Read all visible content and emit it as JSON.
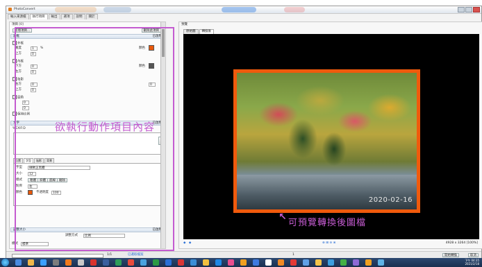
{
  "window": {
    "title": "PhotoConvert",
    "deco_colors": [
      "#e9a86a",
      "#9fb7d4",
      "#6aa0e6",
      "#e46e6e"
    ]
  },
  "main_tabs": [
    "輸入來源檔",
    "執行項目",
    "輸出",
    "選項",
    "說明",
    "關於"
  ],
  "left": {
    "header_label": "項目 [0]",
    "add_button": "新增項目...",
    "delete_button": "刪除此項目",
    "section1_title": "邊框",
    "section1_right": "已啟用",
    "group_outer": "外框",
    "color_label": "顏色",
    "size_label": "寬度",
    "size_value": "1",
    "size_unit": "%",
    "row_a": "上方",
    "row_b": "下方",
    "row_c": "左方",
    "row_d": "右方",
    "value_zero": "0",
    "group_inner": "內框",
    "group_shadow": "陰影",
    "group_round": "圓角",
    "keep_ratio": "保持比例",
    "annotation": "欲執行動作項目內容",
    "section2_title": "文字",
    "section2_right": "已啟用",
    "text_content": "%EXIF:D",
    "sub_tabs": [
      "位置",
      "字型",
      "陰影",
      "背景"
    ],
    "font_label": "字型",
    "font_value": "微軟正黑體",
    "size_row": "大小",
    "size_row_value": "12",
    "style_label": "樣式",
    "style_buttons": [
      "粗體",
      "斜體",
      "底線",
      "刪除"
    ],
    "align_label": "對齊",
    "align_value": "左",
    "color_row": "顏色",
    "opacity_label": "不透明度",
    "opacity_value": "100",
    "section3_title": "調整大小",
    "section3_right": "已啟用",
    "method_label": "調整方式",
    "method_value": "比例",
    "bottom_label": "模式",
    "bottom_value": "標準"
  },
  "right": {
    "header": "預覽",
    "tabs": [
      "原始圖",
      "轉換後"
    ],
    "timestamp": "2020-02-16",
    "note": "可預覽轉換後圖檔",
    "zoom_info": "4928 x 3264 [100%]"
  },
  "status": {
    "left": "1/1",
    "file": "已選取檔案",
    "count": "1",
    "action_button": "開始轉換",
    "cancel_button": "取消"
  },
  "clock": {
    "time": "下午 04:35",
    "date": "2021/2/18"
  },
  "colors": {
    "accent": "#c45bd0",
    "frame_orange": "#f05a0c"
  }
}
